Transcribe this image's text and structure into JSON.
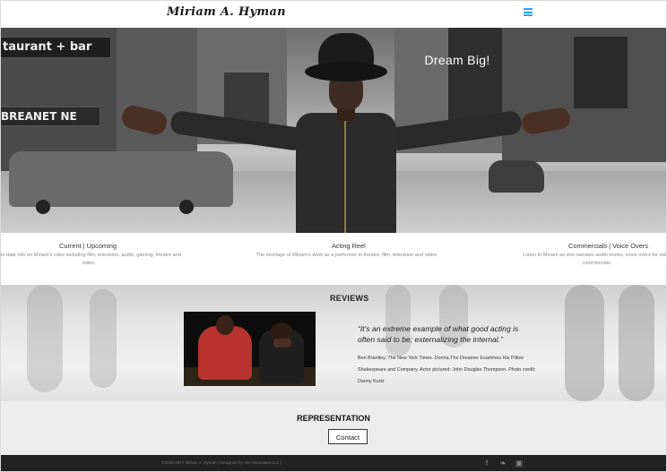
{
  "header": {
    "logo": "Miriam A. Hyman",
    "menu_icon": "hamburger-menu-icon"
  },
  "hero": {
    "title": "Dream Big!",
    "sign_text_1": "taurant + bar",
    "sign_text_2": "BREANET NE"
  },
  "features": [
    {
      "title": "Current | Upcoming",
      "text": "p to date info on Miriam's roles including film, television, audio, gaming, theatre and video."
    },
    {
      "title": "Acting Reel",
      "text": "The montage of Miriam's work as a performer in theatre, film, television and video."
    },
    {
      "title": "Commercials | Voice Overs",
      "text": "Listen to Miriam as she narrates audio books, voice overs for video commercials."
    }
  ],
  "reviews": {
    "title": "REVIEWS",
    "quote": "“It's an extreme example of what good acting is often said to be; externalizing the internal.”",
    "credit": "Ben Brantley, The New York Times. Donna,The Dreamer Examines His Pillow Shakespeare and Company. Actor pictured: John Douglas Thompson. Photo credit: Danny Kurtz"
  },
  "representation": {
    "title": "REPRESENTATION",
    "button": "Contact"
  },
  "footer": {
    "text": "©2016-2017 Miriam A. Hyman | Designed by AM Associates LLC |",
    "social": [
      {
        "icon": "facebook-icon",
        "glyph": "f"
      },
      {
        "icon": "twitter-icon",
        "glyph": "❧"
      },
      {
        "icon": "instagram-icon",
        "glyph": "▣"
      }
    ]
  },
  "colors": {
    "accent": "#2ea3f2",
    "footer_bg": "#222222"
  }
}
